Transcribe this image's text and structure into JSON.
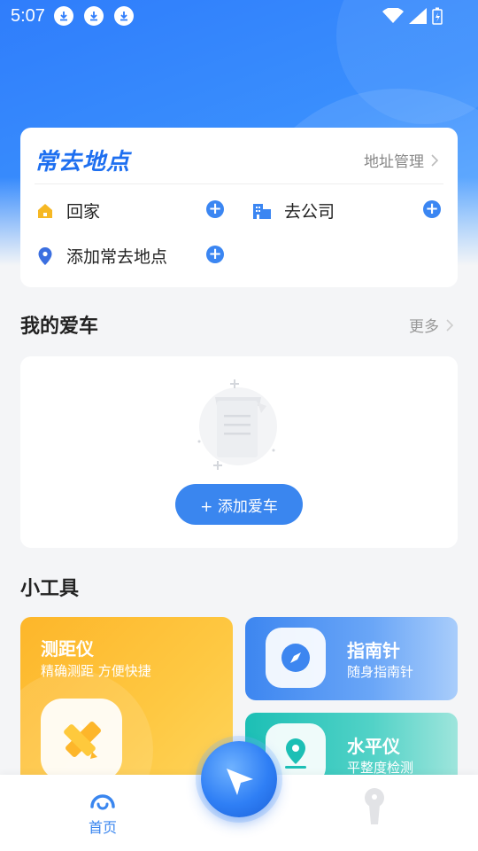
{
  "status_bar": {
    "time": "5:07",
    "download_icons": [
      "download-icon",
      "download-icon",
      "download-icon"
    ]
  },
  "places": {
    "title": "常去地点",
    "manage_label": "地址管理",
    "home_label": "回家",
    "company_label": "去公司",
    "add_label": "添加常去地点"
  },
  "my_cars": {
    "title": "我的爱车",
    "more_label": "更多",
    "add_button_label": "+ 添加爱车"
  },
  "tools": {
    "title": "小工具",
    "items": [
      {
        "title": "测距仪",
        "subtitle": "精确测距 方便快捷"
      },
      {
        "title": "指南针",
        "subtitle": "随身指南针"
      },
      {
        "title": "水平仪",
        "subtitle": "平整度检测"
      }
    ]
  },
  "tabbar": {
    "home_label": "首页"
  },
  "colors": {
    "primary": "#3a86ef",
    "ruler": "#fdb62a",
    "compass": "#3d86f0",
    "level": "#1cbfb5"
  }
}
